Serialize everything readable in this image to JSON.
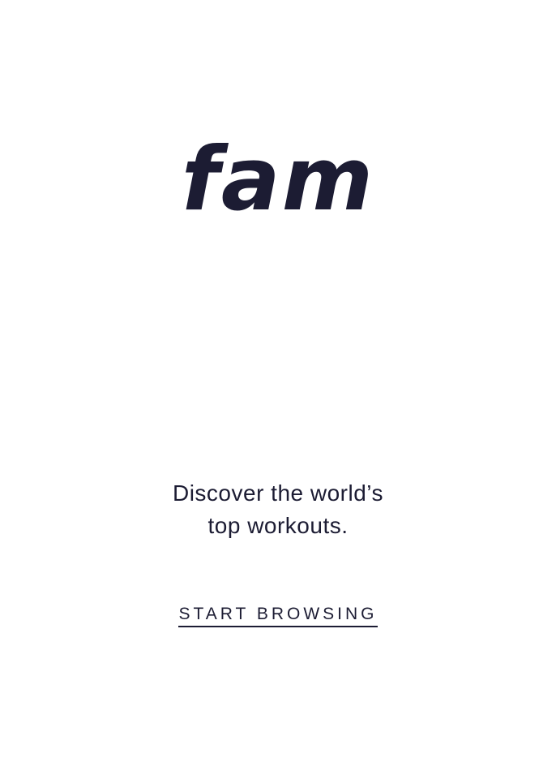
{
  "brand": {
    "logo_text": "fam"
  },
  "intro": {
    "tagline_line1": "Discover the world’s",
    "tagline_line2": "top workouts."
  },
  "actions": {
    "start_label": "START BROWSING"
  },
  "colors": {
    "text": "#1c1c33",
    "background": "#ffffff"
  }
}
